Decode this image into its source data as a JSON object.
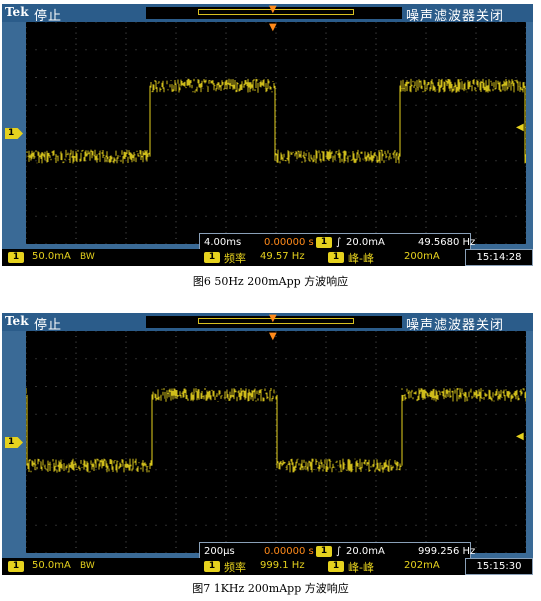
{
  "scopes": [
    {
      "brand": "Tek",
      "state": "停止",
      "noise_filter": "噪声滤波器关闭",
      "channel": "1",
      "timebase": "4.00ms",
      "time_offset": "0.00000 s",
      "trigger_level": "20.0mA",
      "trigger_freq": "49.5680 Hz",
      "volts_div": "50.0mA",
      "bw_label": "BW",
      "meas1_name": "频率",
      "meas1_value": "49.57 Hz",
      "meas2_name": "峰-峰",
      "meas2_value": "200mA",
      "clock": "15:14:28",
      "caption": "图6 50Hz 200mApp 方波响应"
    },
    {
      "brand": "Tek",
      "state": "停止",
      "noise_filter": "噪声滤波器关闭",
      "channel": "1",
      "timebase": "200μs",
      "time_offset": "0.00000 s",
      "trigger_level": "20.0mA",
      "trigger_freq": "999.256 Hz",
      "volts_div": "50.0mA",
      "bw_label": "BW",
      "meas1_name": "频率",
      "meas1_value": "999.1 Hz",
      "meas2_name": "峰-峰",
      "meas2_value": "202mA",
      "clock": "15:15:30",
      "caption": "图7 1KHz 200mApp 方波响应"
    }
  ],
  "colors": {
    "trace": "#e6d21e",
    "accent": "#ff8a1a",
    "frame": "#3a6a96"
  }
}
